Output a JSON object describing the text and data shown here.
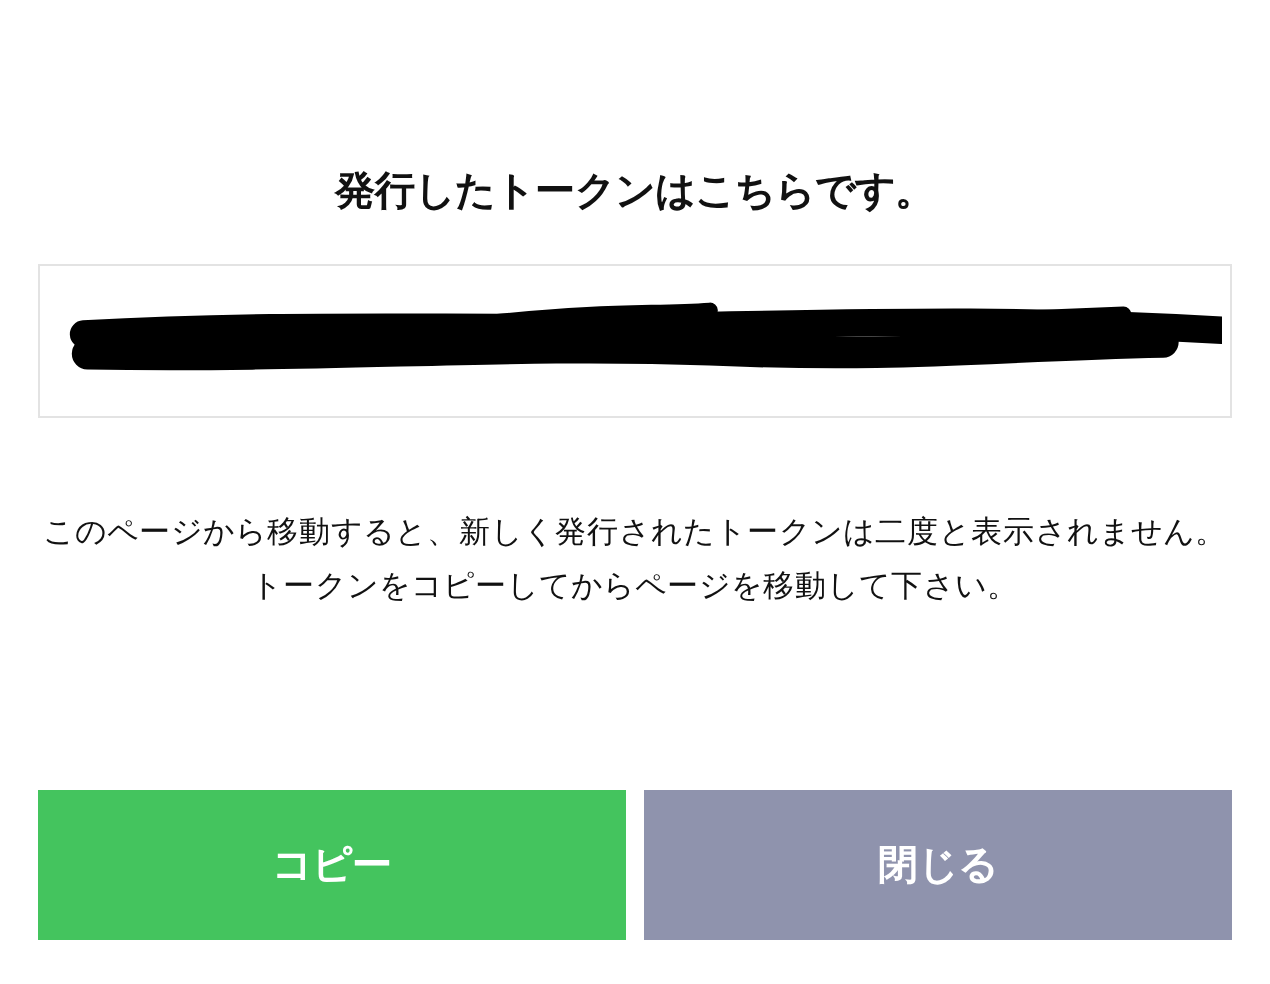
{
  "title": "発行したトークンはこちらです。",
  "token_field": {
    "redacted": true
  },
  "message": "このページから移動すると、新しく発行されたトークンは二度と表示されません。トークンをコピーしてからページを移動して下さい。",
  "buttons": [
    {
      "label": "コピー",
      "kind": "primary"
    },
    {
      "label": "閉じる",
      "kind": "secondary"
    }
  ]
}
